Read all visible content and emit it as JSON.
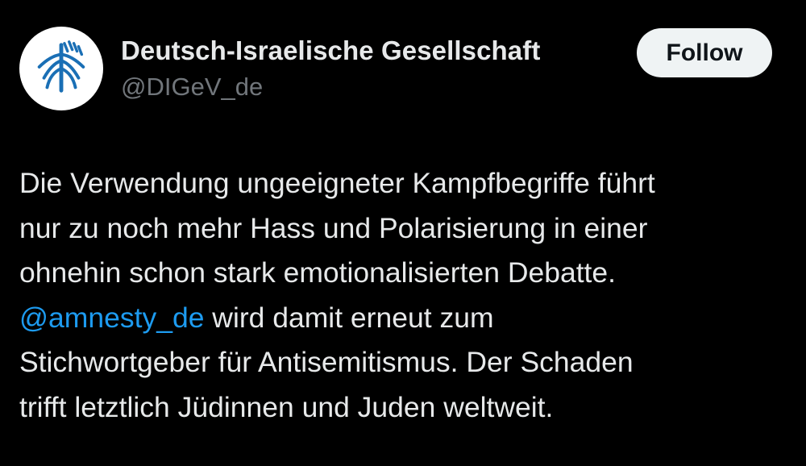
{
  "profile": {
    "display_name": "Deutsch-Israelische Gesellschaft",
    "handle": "@DIGeV_de",
    "avatar_icon": "digev-logo-icon",
    "logo_color": "#1a6fb5"
  },
  "follow_button": {
    "label": "Follow"
  },
  "tweet": {
    "line1": "Die Verwendung ungeeigneter Kampfbegriffe führt",
    "line2": "nur zu noch mehr Hass und Polarisierung in einer",
    "line3": "ohnehin schon stark emotionalisierten Debatte.",
    "mention": "@amnesty_de",
    "line4_rest": " wird damit erneut zum",
    "line5": "Stichwortgeber für Antisemitismus. Der Schaden",
    "line6": "trifft letztlich Jüdinnen und Juden weltweit."
  },
  "colors": {
    "background": "#000000",
    "text": "#e7e9ea",
    "secondary_text": "#71767b",
    "link": "#1d9bf0",
    "button_bg": "#eff3f4"
  }
}
